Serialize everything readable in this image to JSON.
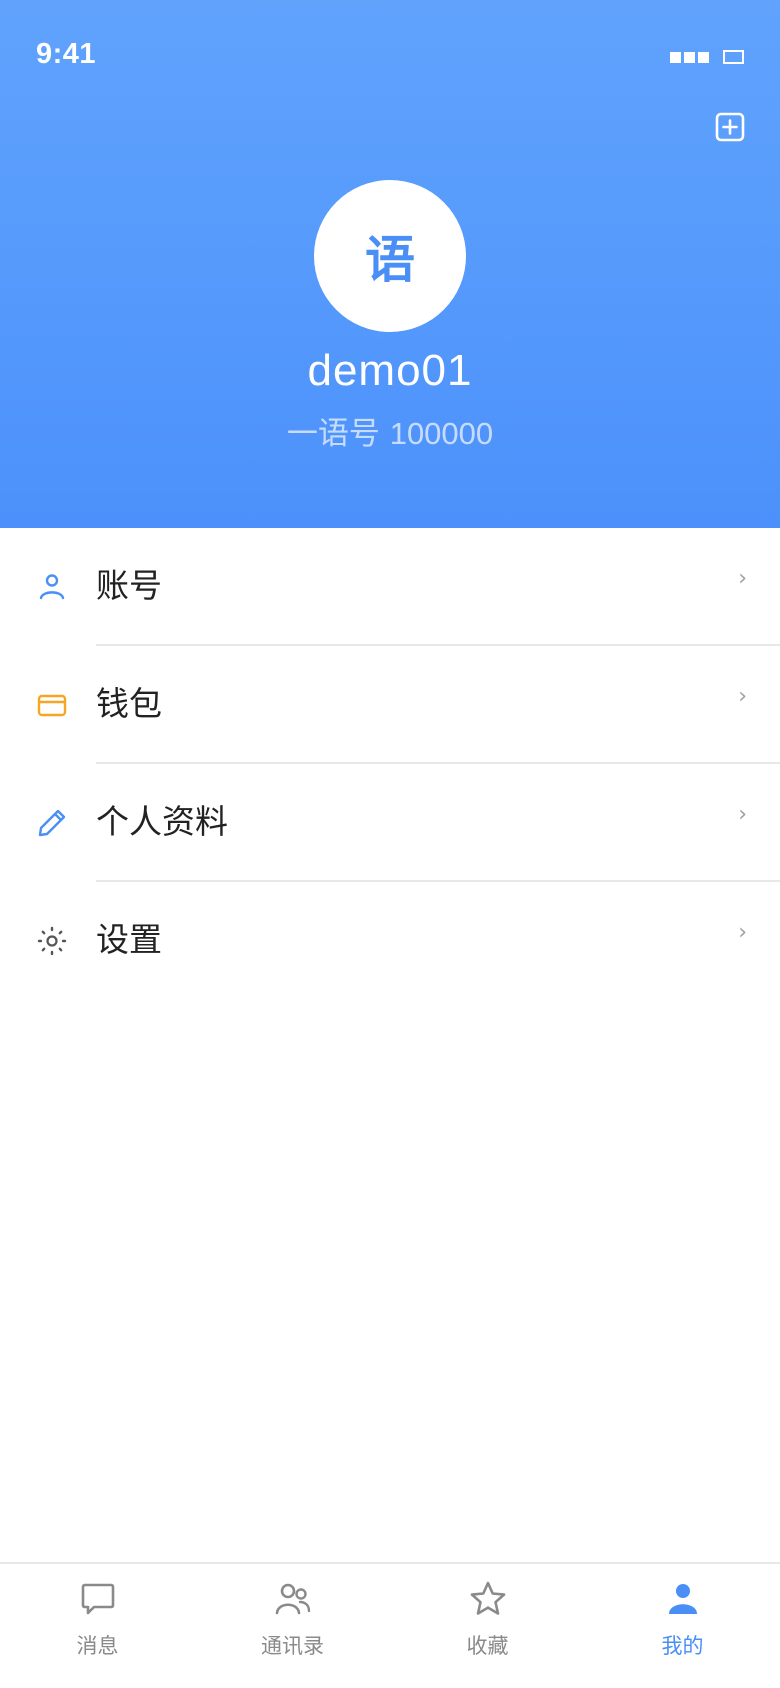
{
  "status_bar": {
    "time": "9:41"
  },
  "header": {
    "add_icon": "plus-square-icon",
    "avatar_text": "语",
    "username": "demo01",
    "id_prefix": "一语号 ",
    "id_value": "100000",
    "gradient_colors": [
      "#60a3fd",
      "#4c91fb"
    ]
  },
  "menu": {
    "items": [
      {
        "label": "账号",
        "icon": "person-icon",
        "icon_color": "#4a8ff6"
      },
      {
        "label": "钱包",
        "icon": "wallet-icon",
        "icon_color": "#f5a623"
      },
      {
        "label": "个人资料",
        "icon": "edit-pencil-icon",
        "icon_color": "#4a8ff6"
      },
      {
        "label": "设置",
        "icon": "settings-gear-icon",
        "icon_color": "#555555"
      }
    ],
    "chevron": "›"
  },
  "tabbar": {
    "tabs": [
      {
        "label": "消息",
        "icon": "message-bubble-icon",
        "active": false
      },
      {
        "label": "通讯录",
        "icon": "contacts-icon",
        "active": false
      },
      {
        "label": "收藏",
        "icon": "star-icon",
        "active": false
      },
      {
        "label": "我的",
        "icon": "person-filled-icon",
        "active": true
      }
    ],
    "active_color": "#4a8ff6",
    "inactive_color": "#8a8a8a"
  }
}
